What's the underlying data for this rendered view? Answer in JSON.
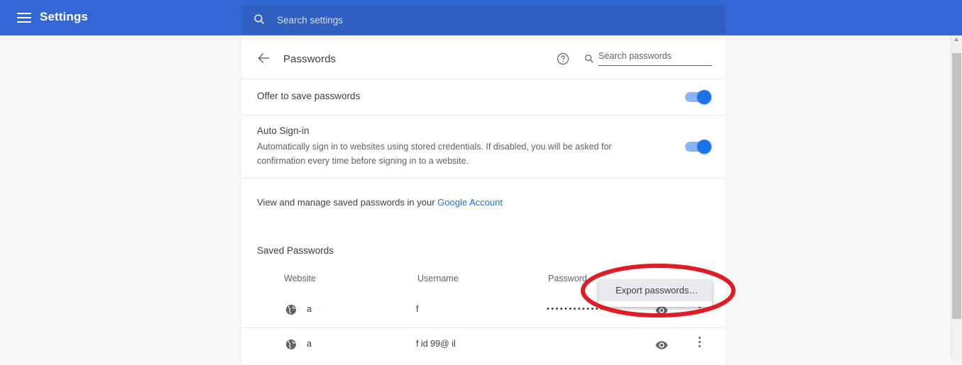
{
  "appbar": {
    "menu_icon": "hamburger-icon",
    "title": "Settings",
    "search_icon": "search-icon",
    "search_placeholder": "Search settings",
    "search_value": "",
    "background_color": "#3367d6",
    "search_background_color": "#2f5fc0"
  },
  "card": {
    "back_icon": "back-arrow-icon",
    "title": "Passwords",
    "help_icon": "help-circle-icon",
    "search_icon": "search-icon",
    "search_placeholder": "Search passwords",
    "search_value": ""
  },
  "settings": {
    "offer_to_save": {
      "label": "Offer to save passwords",
      "toggle_state": "on"
    },
    "auto_signin": {
      "label": "Auto Sign-in",
      "description": "Automatically sign in to websites using stored credentials. If disabled, you will be asked for confirmation every time before signing in to a website.",
      "toggle_state": "on"
    },
    "manage": {
      "text": "View and manage saved passwords in your ",
      "link_label": "Google Account",
      "link_color": "#1a73e8"
    }
  },
  "saved_passwords": {
    "section_title": "Saved Passwords",
    "more_actions_icon": "kebab-menu-icon",
    "columns": {
      "website": "Website",
      "username": "Username",
      "password": "Password"
    },
    "rows": [
      {
        "favicon": "globe-icon",
        "website": "a",
        "website_redacted": "·           ·",
        "username": "f",
        "username_redacted": "",
        "password_masked": "•••••••••••••••",
        "show_icon": "eye-icon",
        "more_icon": "kebab-menu-icon"
      },
      {
        "favicon": "globe-icon",
        "website": "a",
        "website_redacted": "",
        "username": "f         id     99@    il",
        "username_redacted": "",
        "password_masked": "",
        "show_icon": "eye-icon",
        "more_icon": "kebab-menu-icon"
      }
    ]
  },
  "context_menu": {
    "items": [
      {
        "label": "Export passwords…",
        "highlighted": true
      }
    ]
  },
  "annotation": {
    "shape": "ellipse",
    "color": "#e01b24",
    "stroke_width": 6
  },
  "scrollbar": {
    "orientation": "vertical",
    "thumb_color": "#c1c1c1",
    "track_color": "#f1f1f1"
  }
}
